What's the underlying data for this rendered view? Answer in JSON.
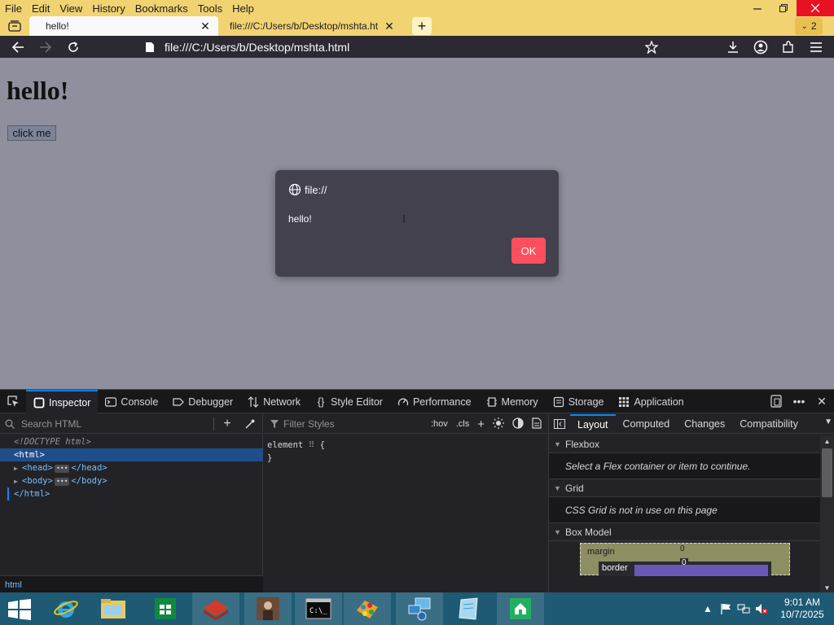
{
  "menubar": {
    "items": [
      {
        "label": "File",
        "key": "F"
      },
      {
        "label": "Edit",
        "key": "E"
      },
      {
        "label": "View",
        "key": "V"
      },
      {
        "label": "History",
        "key": "H"
      },
      {
        "label": "Bookmarks",
        "key": "B"
      },
      {
        "label": "Tools",
        "key": "T"
      },
      {
        "label": "Help",
        "key": "H"
      }
    ]
  },
  "tabs": {
    "active_title": "hello!",
    "inactive_title": "file:///C:/Users/b/Desktop/mshta.ht",
    "count": "2"
  },
  "navbar": {
    "url": "file:///C:/Users/b/Desktop/mshta.html"
  },
  "page": {
    "heading": "hello!",
    "button_label": "click me"
  },
  "dialog": {
    "origin": "file://",
    "message": "hello!",
    "ok_label": "OK"
  },
  "devtools": {
    "tabs": [
      "Inspector",
      "Console",
      "Debugger",
      "Network",
      "Style Editor",
      "Performance",
      "Memory",
      "Storage",
      "Application"
    ],
    "active_tab": "Inspector",
    "search_placeholder": "Search HTML",
    "tree": {
      "doctype": "<!DOCTYPE html>",
      "html_open": "<html>",
      "head_open": "<head>",
      "head_close": "</head>",
      "body_open": "<body>",
      "body_close": "</body>",
      "html_close": "</html>",
      "ellipsis": "•••"
    },
    "breadcrumb": "html",
    "rules": {
      "filter_placeholder": "Filter Styles",
      "hov": ":hov",
      "cls": ".cls",
      "rule_selector": "element",
      "rule_open": "{",
      "rule_close": "}"
    },
    "sidebar": {
      "tabs": [
        "Layout",
        "Computed",
        "Changes",
        "Compatibility"
      ],
      "active_tab": "Layout",
      "flexbox_title": "Flexbox",
      "flexbox_msg": "Select a Flex container or item to continue.",
      "grid_title": "Grid",
      "grid_msg": "CSS Grid is not in use on this page",
      "boxmodel_title": "Box Model",
      "margin_label": "margin",
      "margin_value": "0",
      "border_label": "border",
      "border_value": "0"
    }
  },
  "taskbar": {
    "time": "9:01 AM",
    "date": "10/7/2025"
  },
  "colors": {
    "chrome_yellow": "#f1d372",
    "toolbar": "#2b2a33",
    "accent_blue": "#0a84ff",
    "ok_button": "#ff4f5e",
    "taskbar": "#1e5a74"
  }
}
